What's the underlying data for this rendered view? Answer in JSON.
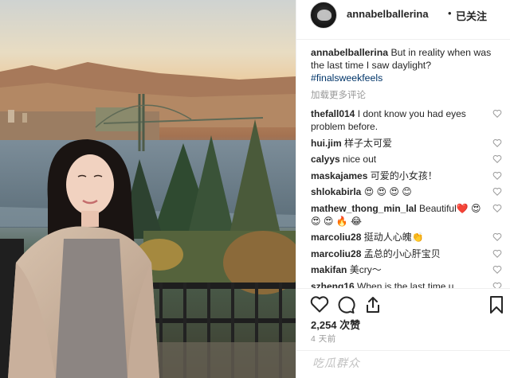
{
  "post": {
    "username": "annabelballerina",
    "separator": "•",
    "follow_status": "已关注",
    "caption_text": "But in reality when was the last time I saw daylight?",
    "hashtag": "#finalsweekfeels",
    "load_more": "加载更多评论",
    "likes": "2,254 次赞",
    "timestamp": "4 天前"
  },
  "comments": [
    {
      "user": "thefall014",
      "text": "I dont know you had eyes problem before."
    },
    {
      "user": "hui.jim",
      "text": "样子太可爱"
    },
    {
      "user": "calyys",
      "text": "nice out"
    },
    {
      "user": "maskajames",
      "text": "可爱的小女孩！"
    },
    {
      "user": "shlokabirla",
      "text": "😍 😍 😍 😊"
    },
    {
      "user": "mathew_thong_min_lal",
      "text": "Beautiful❤️ 😍 😍 😍 🔥 😂"
    },
    {
      "user": "marcoliu28",
      "text": "挺动人心魄👏"
    },
    {
      "user": "marcoliu28",
      "text": "孟总的小心肝宝贝"
    },
    {
      "user": "makifan",
      "text": "美cry～"
    },
    {
      "user": "szheng16",
      "text": "When is the last time u remember?"
    }
  ],
  "icons": {
    "like": "heart-icon",
    "comment": "comment-icon",
    "share": "share-icon",
    "save": "bookmark-icon",
    "comment_like": "heart-icon"
  },
  "watermark": "吃瓜群众"
}
